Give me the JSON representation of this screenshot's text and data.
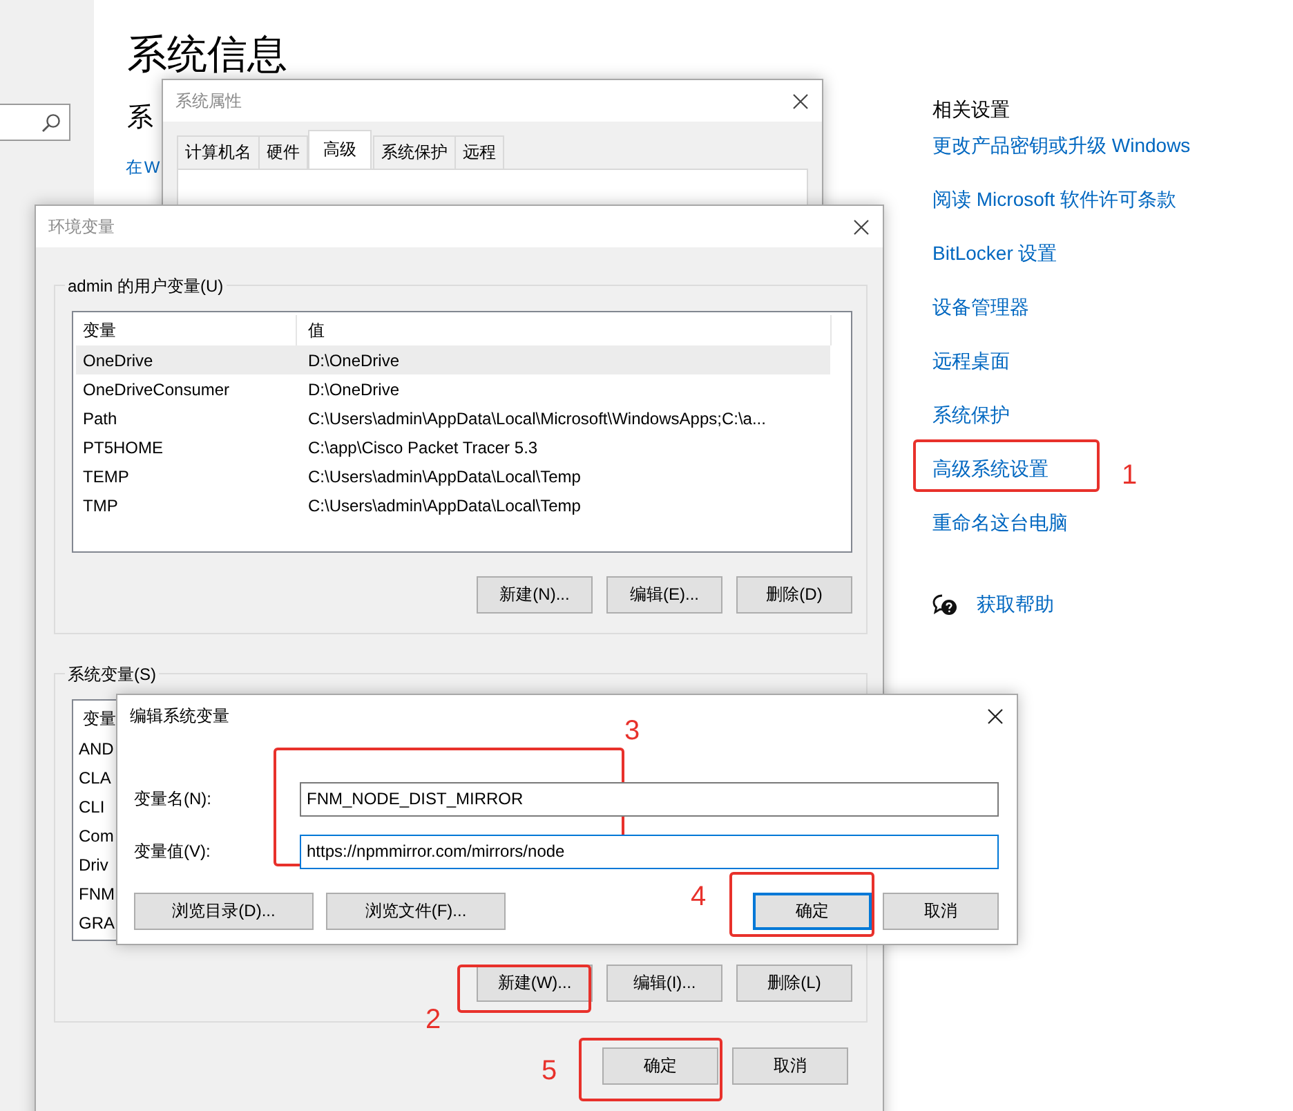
{
  "settings_page": {
    "title": "系统信息",
    "subtitle": "系",
    "link": "在 W",
    "related": {
      "heading": "相关设置",
      "links": [
        "更改产品密钥或升级 Windows",
        "阅读 Microsoft 软件许可条款",
        "BitLocker 设置",
        "设备管理器",
        "远程桌面",
        "系统保护",
        "高级系统设置",
        "重命名这台电脑"
      ],
      "help": "获取帮助"
    }
  },
  "system_properties": {
    "title": "系统属性",
    "tabs": [
      {
        "label": "计算机名",
        "selected": false
      },
      {
        "label": "硬件",
        "selected": false
      },
      {
        "label": "高级",
        "selected": true
      },
      {
        "label": "系统保护",
        "selected": false
      },
      {
        "label": "远程",
        "selected": false
      }
    ]
  },
  "environment_variables": {
    "title": "环境变量",
    "user_group": "admin 的用户变量(U)",
    "user_columns": [
      "变量",
      "值"
    ],
    "user_rows": [
      {
        "name": "OneDrive",
        "value": "D:\\OneDrive",
        "selected": true
      },
      {
        "name": "OneDriveConsumer",
        "value": "D:\\OneDrive",
        "selected": false
      },
      {
        "name": "Path",
        "value": "C:\\Users\\admin\\AppData\\Local\\Microsoft\\WindowsApps;C:\\a...",
        "selected": false
      },
      {
        "name": "PT5HOME",
        "value": "C:\\app\\Cisco Packet Tracer 5.3",
        "selected": false
      },
      {
        "name": "TEMP",
        "value": "C:\\Users\\admin\\AppData\\Local\\Temp",
        "selected": false
      },
      {
        "name": "TMP",
        "value": "C:\\Users\\admin\\AppData\\Local\\Temp",
        "selected": false
      }
    ],
    "user_buttons": [
      "新建(N)...",
      "编辑(E)...",
      "删除(D)"
    ],
    "system_group": "系统变量(S)",
    "system_column": "变量",
    "system_rows": [
      "AND",
      "CLA",
      "CLI",
      "Com",
      "Driv",
      "FNM",
      "GRA"
    ],
    "system_buttons": [
      "新建(W)...",
      "编辑(I)...",
      "删除(L)"
    ],
    "buttons": [
      "确定",
      "取消"
    ]
  },
  "edit_dialog": {
    "title": "编辑系统变量",
    "fields": [
      {
        "label": "变量名(N):",
        "value": "FNM_NODE_DIST_MIRROR",
        "focused": false
      },
      {
        "label": "变量值(V):",
        "value": "https://npmmirror.com/mirrors/node",
        "focused": true
      }
    ],
    "browse_buttons": [
      "浏览目录(D)...",
      "浏览文件(F)..."
    ],
    "buttons": [
      {
        "label": "确定",
        "default": true
      },
      {
        "label": "取消",
        "default": false
      }
    ]
  },
  "annotations": [
    {
      "label": "1"
    },
    {
      "label": "2"
    },
    {
      "label": "3"
    },
    {
      "label": "4"
    },
    {
      "label": "5"
    }
  ]
}
